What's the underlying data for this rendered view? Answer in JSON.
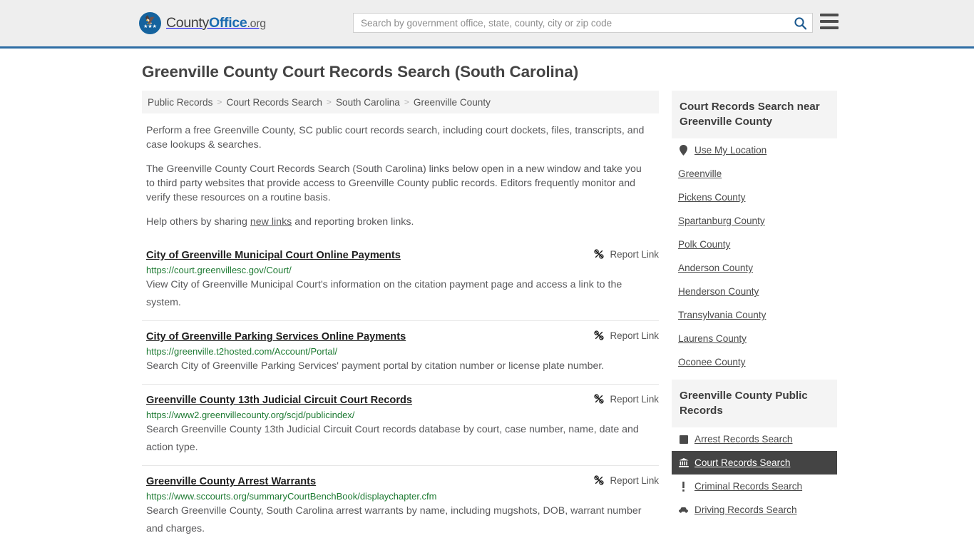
{
  "header": {
    "brand": {
      "part1": "County",
      "part2": "Office",
      "part3": ".org",
      "seal_icon": "eagle-seal-icon"
    },
    "search": {
      "placeholder": "Search by government office, state, county, city or zip code",
      "value": "",
      "search_icon": "search-icon"
    },
    "menu_icon": "hamburger-menu-icon",
    "accent_color": "#2e6da4",
    "bg_color": "#eeeeee"
  },
  "page_title": "Greenville County Court Records Search (South Carolina)",
  "breadcrumb": {
    "separator": ">",
    "items": [
      {
        "label": "Public Records"
      },
      {
        "label": "Court Records Search"
      },
      {
        "label": "South Carolina"
      },
      {
        "label": "Greenville County"
      }
    ]
  },
  "intro": {
    "p1": "Perform a free Greenville County, SC public court records search, including court dockets, files, transcripts, and case lookups & searches.",
    "p2": "The Greenville County Court Records Search (South Carolina) links below open in a new window and take you to third party websites that provide access to Greenville County public records. Editors frequently monitor and verify these resources on a routine basis.",
    "p3_before": "Help others by sharing ",
    "p3_link": "new links",
    "p3_after": " and reporting broken links."
  },
  "report_link_label": "Report Link",
  "report_link_icon": "broken-link-icon",
  "results": [
    {
      "title": "City of Greenville Municipal Court Online Payments",
      "url": "https://court.greenvillesc.gov/Court/",
      "description": "View City of Greenville Municipal Court's information on the citation payment page and access a link to the system."
    },
    {
      "title": "City of Greenville Parking Services Online Payments",
      "url": "https://greenville.t2hosted.com/Account/Portal/",
      "description": "Search City of Greenville Parking Services' payment portal by citation number or license plate number."
    },
    {
      "title": "Greenville County 13th Judicial Circuit Court Records",
      "url": "https://www2.greenvillecounty.org/scjd/publicindex/",
      "description": "Search Greenville County 13th Judicial Circuit Court records database by court, case number, name, date and action type."
    },
    {
      "title": "Greenville County Arrest Warrants",
      "url": "https://www.sccourts.org/summaryCourtBenchBook/displaychapter.cfm",
      "description": "Search Greenville County, South Carolina arrest warrants by name, including mugshots, DOB, warrant number and charges."
    }
  ],
  "sidebar": {
    "nearby": {
      "title": "Court Records Search near Greenville County",
      "items": [
        {
          "label": "Use My Location",
          "icon": "map-pin-icon"
        },
        {
          "label": "Greenville",
          "icon": ""
        },
        {
          "label": "Pickens County",
          "icon": ""
        },
        {
          "label": "Spartanburg County",
          "icon": ""
        },
        {
          "label": "Polk County",
          "icon": ""
        },
        {
          "label": "Anderson County",
          "icon": ""
        },
        {
          "label": "Henderson County",
          "icon": ""
        },
        {
          "label": "Transylvania County",
          "icon": ""
        },
        {
          "label": "Laurens County",
          "icon": ""
        },
        {
          "label": "Oconee County",
          "icon": ""
        }
      ]
    },
    "public_records": {
      "title": "Greenville County Public Records",
      "items": [
        {
          "label": "Arrest Records Search",
          "icon": "fingerprint-square-icon",
          "active": false
        },
        {
          "label": "Court Records Search",
          "icon": "courthouse-icon",
          "active": true
        },
        {
          "label": "Criminal Records Search",
          "icon": "exclamation-icon",
          "active": false
        },
        {
          "label": "Driving Records Search",
          "icon": "car-icon",
          "active": false
        }
      ]
    }
  }
}
